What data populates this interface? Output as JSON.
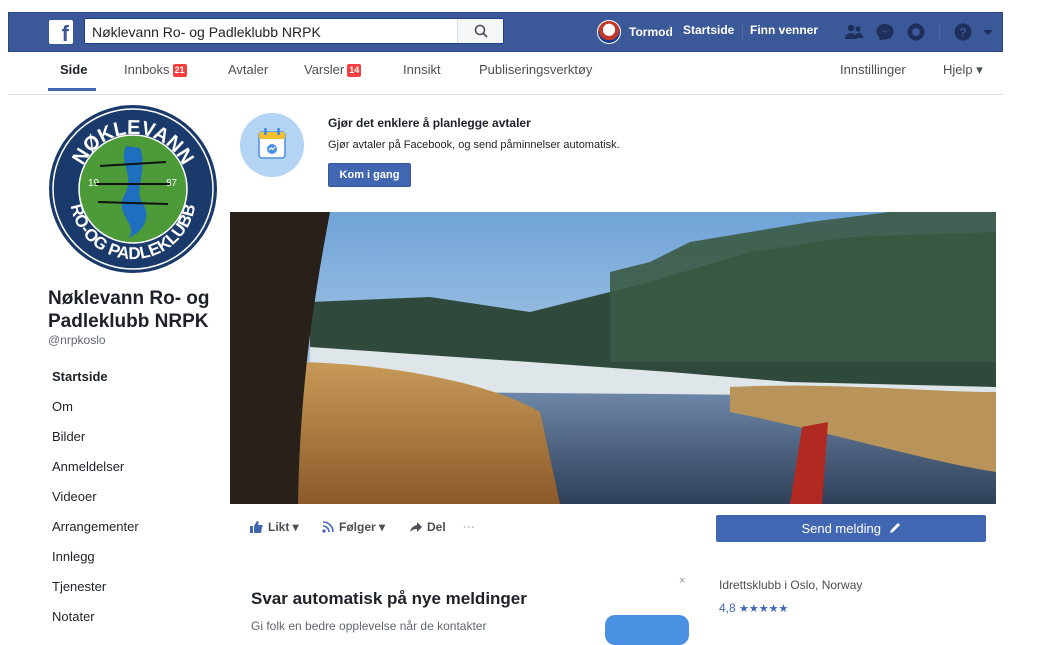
{
  "topbar": {
    "search_value": "Nøklevann Ro- og Padleklubb NRPK",
    "user_name": "Tormod",
    "home_label": "Startside",
    "find_friends_label": "Finn venner",
    "icons": [
      "friend-requests-icon",
      "messages-icon",
      "notifications-icon",
      "help-icon",
      "account-menu-icon"
    ]
  },
  "tabs": [
    {
      "label": "Side",
      "active": true
    },
    {
      "label": "Innboks",
      "badge": "21"
    },
    {
      "label": "Avtaler"
    },
    {
      "label": "Varsler",
      "badge": "14"
    },
    {
      "label": "Innsikt"
    },
    {
      "label": "Publiseringsverktøy"
    },
    {
      "label": "Innstillinger"
    },
    {
      "label": "Hjelp ▾"
    }
  ],
  "page": {
    "name": "Nøklevann Ro- og Padleklubb NRPK",
    "handle": "@nrpkoslo",
    "logo": {
      "top_text": "NØKLEVANN",
      "bottom_text": "RO-OG PADLEKLUBB",
      "year_left": "19",
      "year_right": "87"
    }
  },
  "sidenav": [
    "Startside",
    "Om",
    "Bilder",
    "Anmeldelser",
    "Videoer",
    "Arrangementer",
    "Innlegg",
    "Tjenester",
    "Notater"
  ],
  "promo": {
    "title": "Gjør det enklere å planlegge avtaler",
    "text": "Gjør avtaler på Facebook, og send påminnelser automatisk.",
    "button": "Kom i gang"
  },
  "actions": {
    "like": "Likt ▾",
    "follow": "Følger ▾",
    "share": "Del",
    "more": "···"
  },
  "send_message": "Send melding",
  "auto_reply": {
    "title": "Svar automatisk på nye meldinger",
    "text": "Gi folk en bedre opplevelse når de kontakter",
    "close": "×"
  },
  "info": {
    "category": "Idrettsklubb i Oslo, Norway",
    "rating": "4,8",
    "stars": "★★★★★"
  },
  "colors": {
    "facebook_blue": "#3b5998",
    "button_blue": "#4267b2",
    "badge_red": "#fa3e3e",
    "logo_green": "#4c9a38",
    "logo_navy": "#1a3a6b"
  }
}
